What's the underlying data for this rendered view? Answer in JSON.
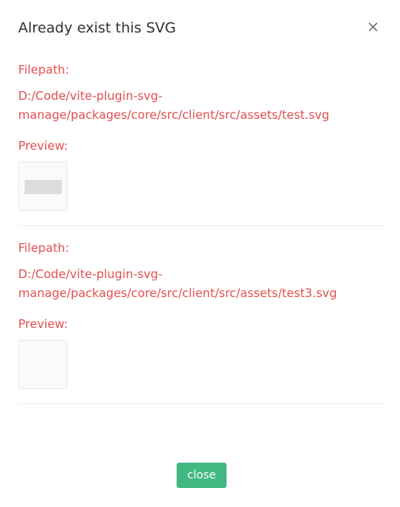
{
  "dialog": {
    "title": "Already exist this SVG",
    "close_icon": "close-x-icon"
  },
  "entries": [
    {
      "filepath_label": "Filepath:",
      "filepath_line1": "D:/Code/vite-plugin-svg-",
      "filepath_line2": "manage/packages/core/src/client/src/assets/test.svg",
      "preview_label": "Preview:"
    },
    {
      "filepath_label": "Filepath:",
      "filepath_line1": "D:/Code/vite-plugin-svg-",
      "filepath_line2": "manage/packages/core/src/client/src/assets/test3.svg",
      "preview_label": "Preview:"
    }
  ],
  "footer": {
    "close_label": "close"
  },
  "colors": {
    "accent": "#42b883",
    "error_text": "#e2504f"
  }
}
